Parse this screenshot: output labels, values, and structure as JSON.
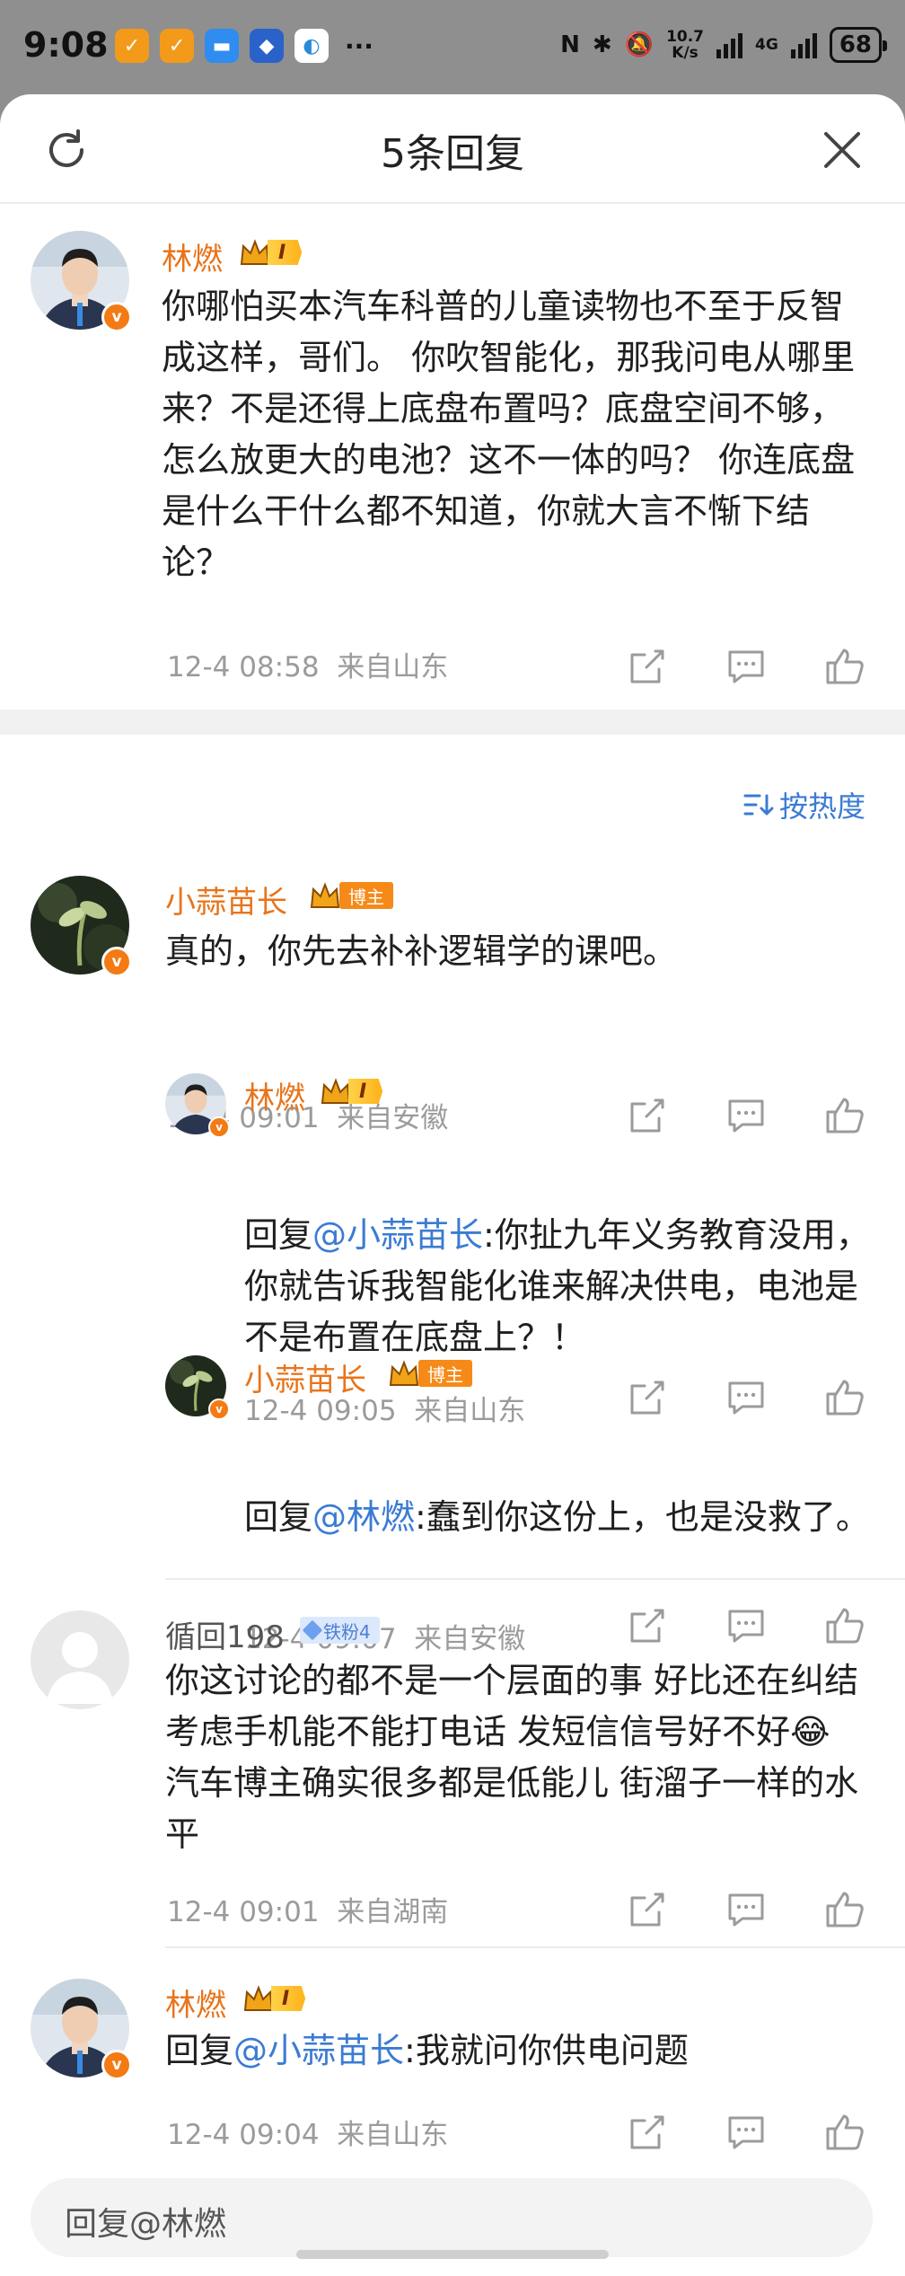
{
  "status_bar": {
    "time": "9:08",
    "app_icons": [
      "taobao-icon",
      "taobao-icon",
      "messages-icon",
      "app-icon",
      "app-icon"
    ],
    "more": "···",
    "net_speed_value": "10.7",
    "net_speed_unit": "K/s",
    "network": "4G",
    "battery": "68"
  },
  "header": {
    "title": "5条回复"
  },
  "sort_label": "按热度",
  "main_comment": {
    "author": "林燃",
    "level": "I",
    "text": "你哪怕买本汽车科普的儿童读物也不至于反智成这样，哥们。 你吹智能化，那我问电从哪里来？不是还得上底盘布置吗？底盘空间不够，怎么放更大的电池？这不一体的吗？ 你连底盘是什么干什么都不知道，你就大言不惭下结论？",
    "time": "12-4 08:58",
    "location": "来自山东"
  },
  "replies": [
    {
      "author": "小蒜苗长",
      "badge": "博主",
      "text": "真的，你先去补补逻辑学的课吧。",
      "time": "12-4 09:01",
      "location": "来自安徽",
      "sub_replies": [
        {
          "author": "林燃",
          "level": "I",
          "prefix": "回复",
          "mention": "@小蒜苗长",
          "text": ":你扯九年义务教育没用，你就告诉我智能化谁来解决供电，电池是不是布置在底盘上？！",
          "time": "12-4 09:05",
          "location": "来自山东"
        },
        {
          "author": "小蒜苗长",
          "badge": "博主",
          "prefix": "回复",
          "mention": "@林燃",
          "text": ":蠢到你这份上，也是没救了。",
          "time": "12-4 09:07",
          "location": "来自安徽"
        }
      ]
    },
    {
      "author": "循回198",
      "badge": "铁粉4",
      "text_a": "你这讨论的都不是一个层面的事  好比还在纠结考虑手机能不能打电话  发短信信号好不好",
      "emoji": "😂",
      "text_b": "    汽车博主确实很多都是低能儿   街溜子一样的水平",
      "time": "12-4 09:01",
      "location": "来自湖南"
    },
    {
      "author": "林燃",
      "level": "I",
      "prefix": "回复",
      "mention": "@小蒜苗长",
      "text": ":我就问你供电问题",
      "time": "12-4 09:04",
      "location": "来自山东"
    }
  ],
  "reply_input": {
    "placeholder": "回复@林燃"
  },
  "colors": {
    "name_orange": "#e8741b",
    "mention_blue": "#3b7bd4",
    "meta_gray": "#9b9b9b"
  }
}
